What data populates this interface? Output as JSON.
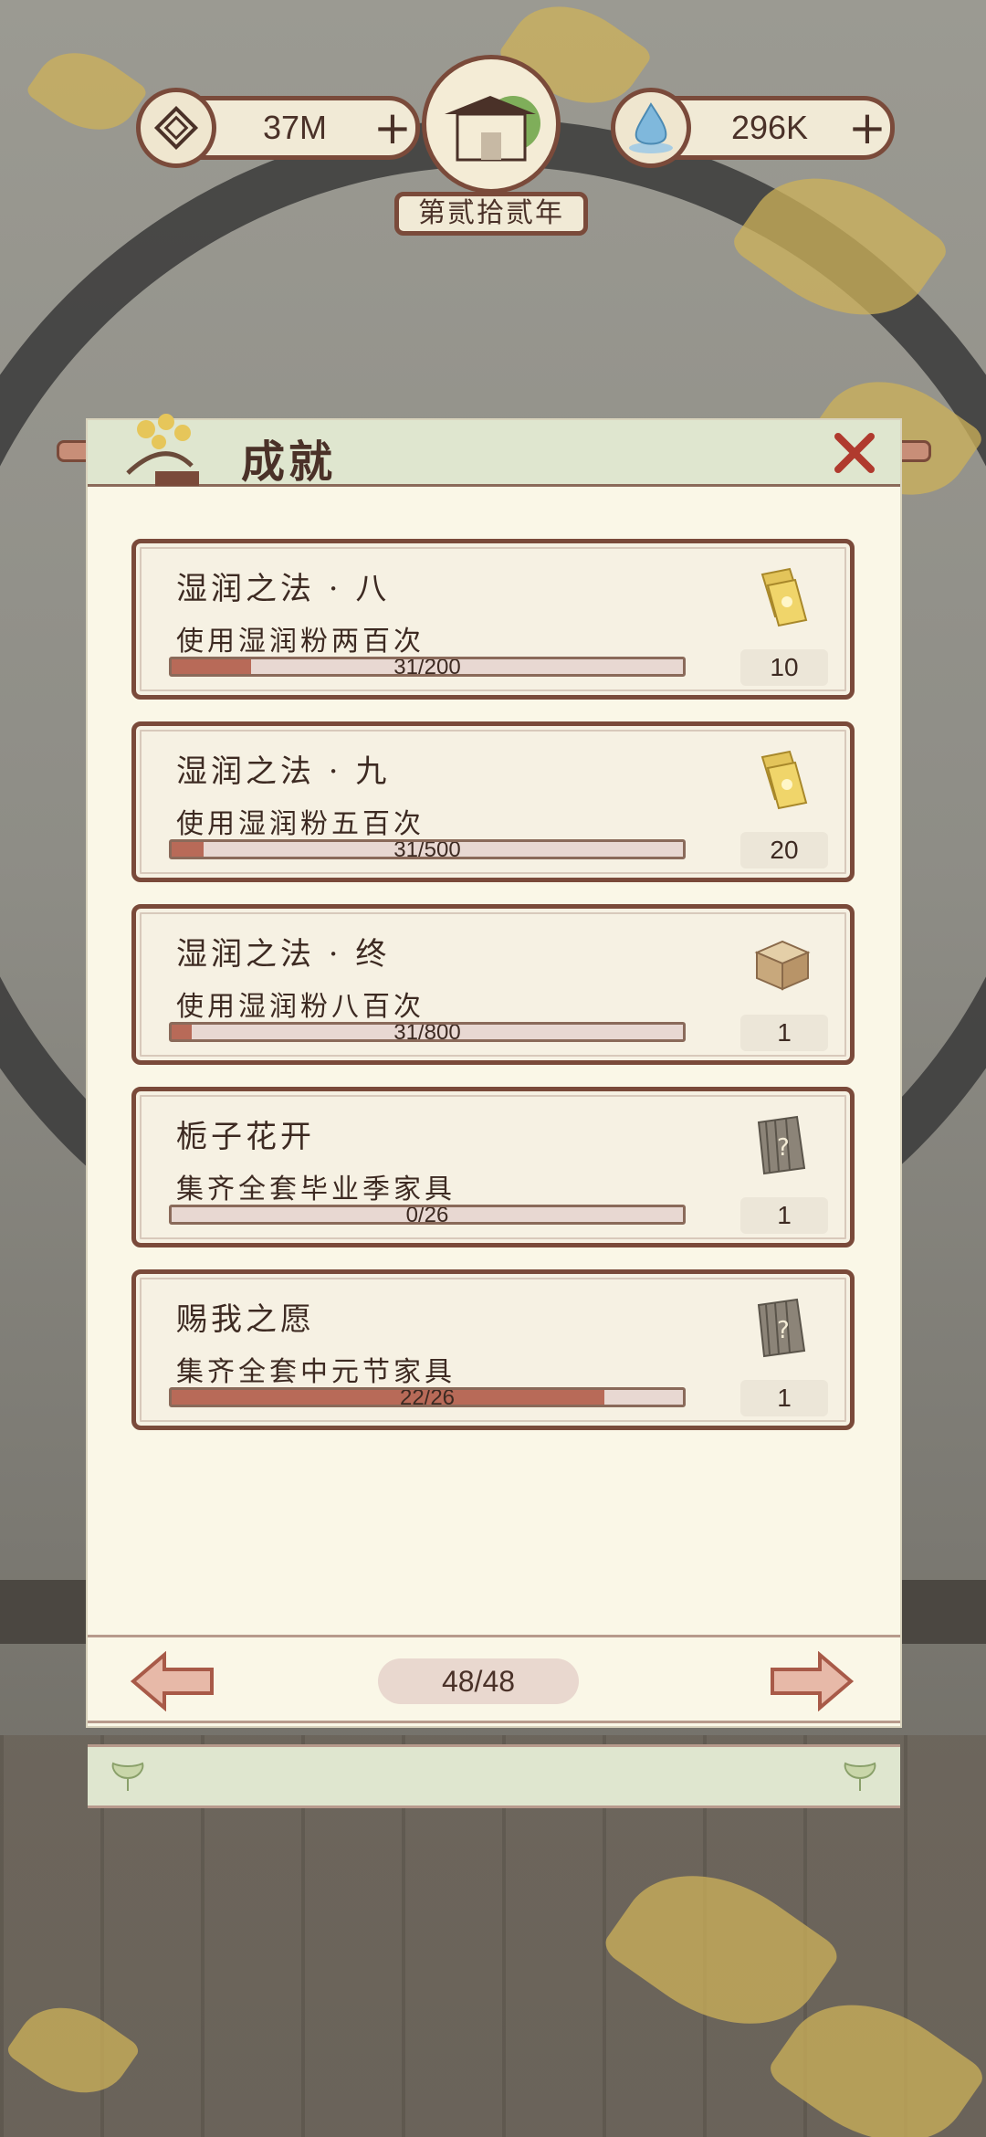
{
  "hud": {
    "coins": {
      "value": "37M",
      "icon": "coin-icon"
    },
    "water": {
      "value": "296K",
      "icon": "water-drop-icon"
    },
    "year": "第贰拾贰年"
  },
  "panel": {
    "title": "成就",
    "achievements": [
      {
        "name": "湿润之法 · 八",
        "desc": "使用湿润粉两百次",
        "progress_text": "31/200",
        "progress": 0.155,
        "reward_icon": "ticket-icon",
        "reward_count": "10"
      },
      {
        "name": "湿润之法 · 九",
        "desc": "使用湿润粉五百次",
        "progress_text": "31/500",
        "progress": 0.062,
        "reward_icon": "ticket-icon",
        "reward_count": "20"
      },
      {
        "name": "湿润之法 · 终",
        "desc": "使用湿润粉八百次",
        "progress_text": "31/800",
        "progress": 0.039,
        "reward_icon": "wooden-box-icon",
        "reward_count": "1"
      },
      {
        "name": "栀子花开",
        "desc": "集齐全套毕业季家具",
        "progress_text": "0/26",
        "progress": 0,
        "reward_icon": "mystery-scroll-icon",
        "reward_count": "1"
      },
      {
        "name": "赐我之愿",
        "desc": "集齐全套中元节家具",
        "progress_text": "22/26",
        "progress": 0.846,
        "reward_icon": "mystery-scroll-icon",
        "reward_count": "1"
      }
    ],
    "page": "48/48"
  },
  "colors": {
    "border": "#7a4a3a",
    "paper": "#faf7e7",
    "bar_fill": "#b86a58",
    "header": "#dfe6cf"
  }
}
